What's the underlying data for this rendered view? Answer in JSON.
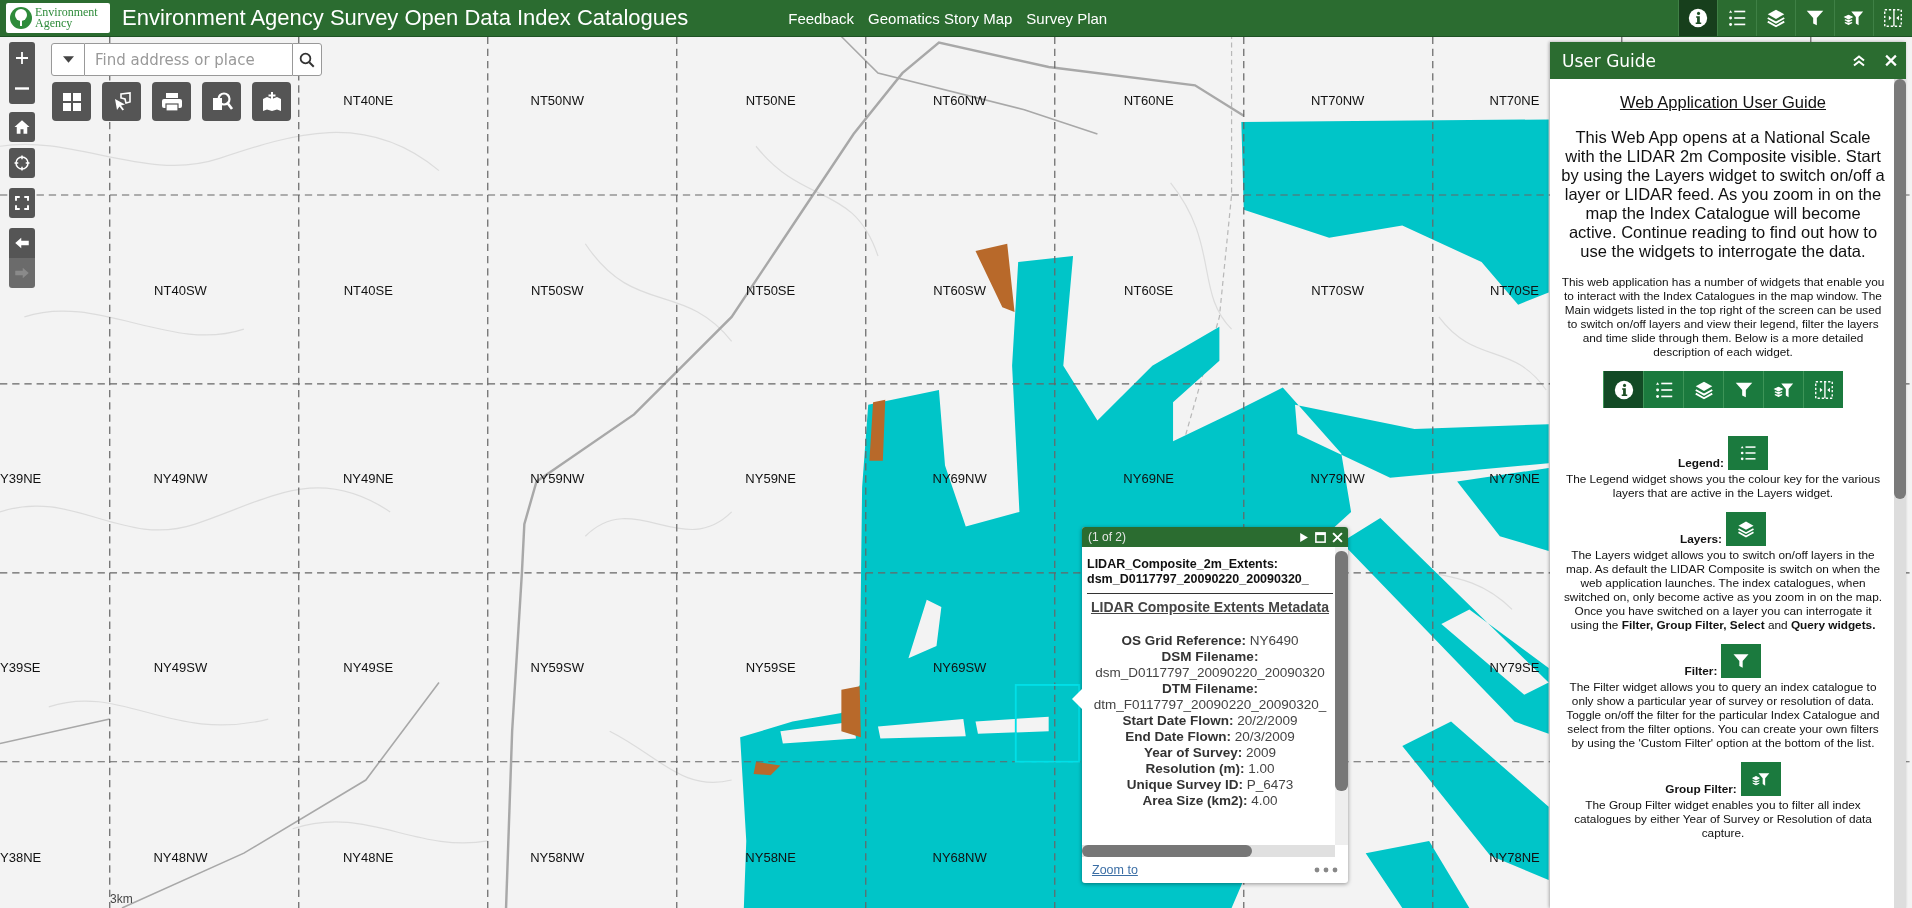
{
  "header": {
    "logo_text": "Environment Agency",
    "title": "Environment Agency Survey Open Data Index Catalogues",
    "links": [
      "Feedback",
      "Geomatics Story Map",
      "Survey Plan"
    ],
    "widgets": [
      {
        "kind": "info",
        "selected": true
      },
      {
        "kind": "legend",
        "selected": false
      },
      {
        "kind": "layers",
        "selected": false
      },
      {
        "kind": "filter",
        "selected": false
      },
      {
        "kind": "group-filter",
        "selected": false
      },
      {
        "kind": "split",
        "selected": false
      }
    ]
  },
  "search": {
    "placeholder": "Find address or place"
  },
  "map_controls": [
    {
      "kind": "zoom-in",
      "disabled": false
    },
    {
      "kind": "zoom-out",
      "disabled": false
    },
    {
      "kind": "home",
      "disabled": false
    },
    {
      "kind": "locate",
      "disabled": false
    },
    {
      "kind": "fullscreen",
      "disabled": false
    },
    {
      "kind": "back",
      "disabled": false
    },
    {
      "kind": "forward",
      "disabled": true
    }
  ],
  "tool_buttons": [
    {
      "kind": "grid"
    },
    {
      "kind": "select"
    },
    {
      "kind": "print"
    },
    {
      "kind": "query"
    },
    {
      "kind": "add-data"
    }
  ],
  "map": {
    "grid_rows": [
      [
        null,
        null,
        "NT40NE",
        "NT50NW",
        "NT50NE",
        "NT60NW",
        "NT60NE",
        "NT70NW",
        "NT70NE"
      ],
      [
        null,
        "NT40SW",
        "NT40SE",
        "NT50SW",
        "NT50SE",
        "NT60SW",
        "NT60SE",
        "NT70SW",
        "NT70SE"
      ],
      [
        "Y39NE",
        "NY49NW",
        "NY49NE",
        "NY59NW",
        "NY59NE",
        "NY69NW",
        "NY69NE",
        "NY79NW",
        "NY79NE"
      ],
      [
        "Y39SE",
        "NY49SW",
        "NY49SE",
        "NY59SW",
        "NY59SE",
        "NY69SW",
        null,
        null,
        "NY79SE"
      ],
      [
        "Y38NE",
        "NY48NW",
        "NY48NE",
        "NY58NW",
        "NY58NE",
        "NY68NW",
        null,
        null,
        "NY78NE"
      ]
    ],
    "scale_bar": "3km"
  },
  "popup": {
    "pager": "(1 of 2)",
    "heading": "LIDAR_Composite_2m_Extents: dsm_D0117797_20090220_20090320_",
    "section_title": "LIDAR Composite Extents Metadata",
    "fields": [
      {
        "label": "OS Grid Reference:",
        "value": "NY6490"
      },
      {
        "label": "DSM Filename:",
        "value": "dsm_D0117797_20090220_20090320"
      },
      {
        "label": "DTM Filename:",
        "value": "dtm_F0117797_20090220_20090320_"
      },
      {
        "label": "Start Date Flown:",
        "value": "20/2/2009"
      },
      {
        "label": "End Date Flown:",
        "value": "20/3/2009"
      },
      {
        "label": "Year of Survey:",
        "value": "2009"
      },
      {
        "label": "Resolution (m):",
        "value": "1.00"
      },
      {
        "label": "Unique Survey ID:",
        "value": "P_6473"
      },
      {
        "label": "Area Size (km2):",
        "value": "4.00"
      }
    ],
    "link": "Zoom to"
  },
  "panel": {
    "title": "User Guide",
    "heading": "Web Application User Guide",
    "intro": "This Web App opens at a National Scale with the LIDAR 2m Composite visible. Start by using the Layers widget to switch on/off a layer or LIDAR feed. As you zoom in on the map the Index Catalogue will become active. Continue reading to find out how to use the widgets to interrogate the data.",
    "description": "This web application has a number of widgets that enable you to interact with the Index Catalogues in the map window. The Main widgets listed in the top right of the screen can be used to switch on/off layers and view their legend, filter the layers and time slide through them. Below is a more detailed description of each widget.",
    "widget_strip": [
      {
        "kind": "info",
        "selected": true
      },
      {
        "kind": "legend",
        "selected": false
      },
      {
        "kind": "layers",
        "selected": false
      },
      {
        "kind": "filter",
        "selected": false
      },
      {
        "kind": "group-filter",
        "selected": false
      },
      {
        "kind": "split",
        "selected": false
      }
    ],
    "sections": [
      {
        "kind": "legend",
        "label": "Legend:",
        "text": "The Legend widget shows you the colour key for the various layers that are active in the Layers widget."
      },
      {
        "kind": "layers",
        "label": "Layers:",
        "text": "The Layers widget allows you to switch on/off layers in the map. As default the LIDAR Composite is switch on when the web application launches. The index catalogues, when switched on, only become active as you zoom in on the map. Once you have switched on a layer you can interrogate it using the **Filter, Group Filter, Select** and **Query widgets.**"
      },
      {
        "kind": "filter",
        "label": "Filter:",
        "text": "The Filter widget allows you to query an index catalogue to only show a particular year of survey or resolution of data. Toggle on/off the filter for the particular Index Catalogue and select from the filter options. You can create your own filters by using the 'Custom Filter' option at the bottom of the list."
      },
      {
        "kind": "group-filter",
        "label": "Group Filter:",
        "text": "The Group Filter widget enables you to filter all index catalogues by either Year of Survey or Resolution of data capture."
      }
    ]
  }
}
